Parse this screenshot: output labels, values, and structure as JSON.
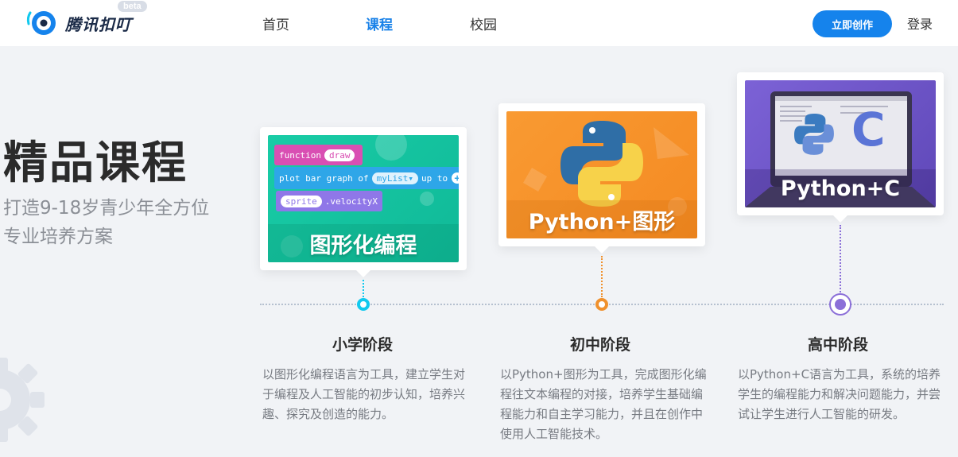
{
  "header": {
    "brand_name": "腾讯扣叮",
    "beta_badge": "beta",
    "nav": [
      {
        "label": "首页",
        "active": false
      },
      {
        "label": "课程",
        "active": true
      },
      {
        "label": "校园",
        "active": false
      }
    ],
    "create_button": "立即创作",
    "login": "登录"
  },
  "hero": {
    "title": "精品课程",
    "subtitle_line1": "打造9-18岁青少年全方位",
    "subtitle_line2": "专业培养方案"
  },
  "stages": [
    {
      "card_label": "图形化编程",
      "title": "小学阶段",
      "description": "以图形化编程语言为工具，建立学生对于编程及人工智能的初步认知，培养兴趣、探究及创造的能力。",
      "color": "#11c9ee",
      "code_blocks": {
        "function": "function",
        "draw": "draw",
        "plot": "plot bar graph of",
        "mylist": "myList▾",
        "upto": "up to",
        "sprite": "sprite",
        "velocity": ".velocityX"
      }
    },
    {
      "card_label": "Python+图形",
      "title": "初中阶段",
      "description": "以Python+图形为工具，完成图形化编程往文本编程的对接，培养学生基础编程能力和自主学习能力，并且在创作中使用人工智能技术。",
      "color": "#f0912d"
    },
    {
      "card_label": "Python+C",
      "title": "高中阶段",
      "description": "以Python+C语言为工具，系统的培养学生的编程能力和解决问题能力，并尝试让学生进行人工智能的研发。",
      "color": "#8b6fd8",
      "c_glyph": "C"
    }
  ],
  "colors": {
    "accent": "#1583ec",
    "timeline": "#b5c0cf",
    "card1_bg": "#17c9a0",
    "card2_bg": "#f7932a",
    "card3_bg": "#6d57c9"
  }
}
